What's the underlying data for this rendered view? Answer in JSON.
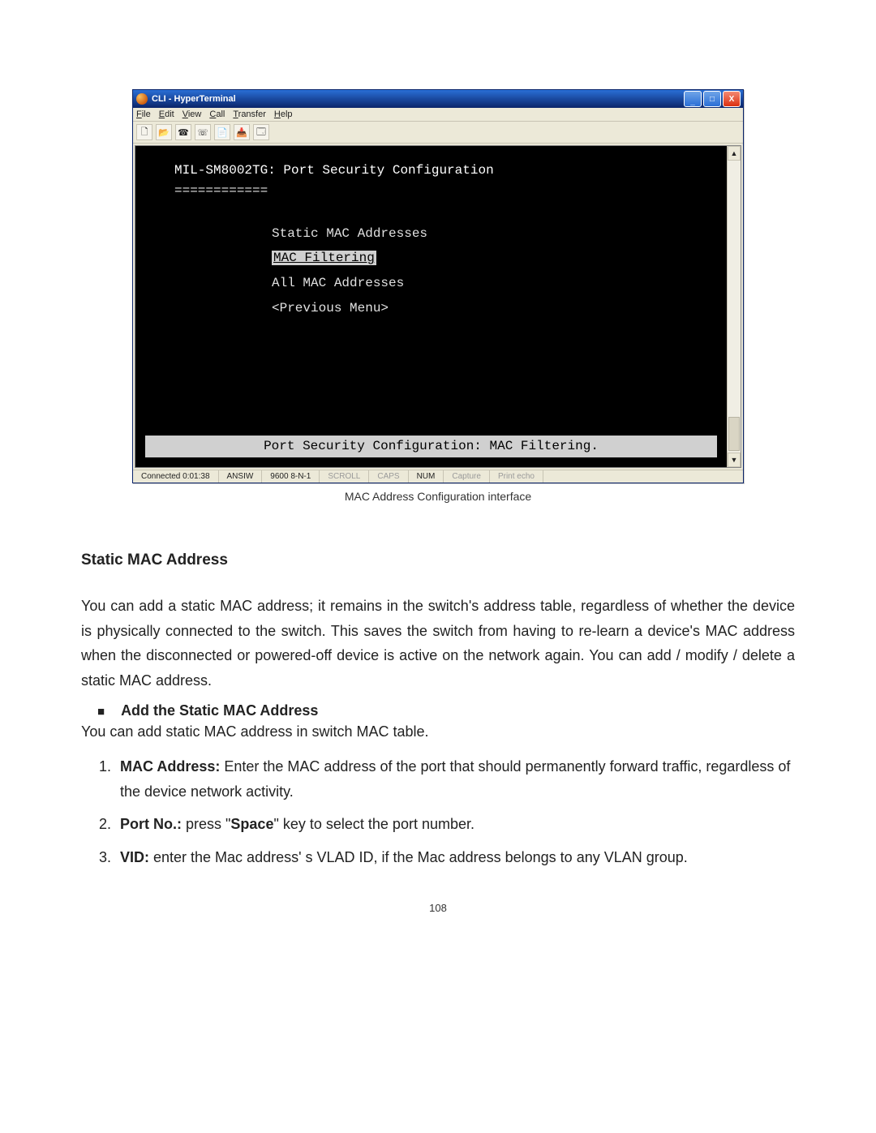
{
  "hyperterminal": {
    "title": "CLI - HyperTerminal",
    "menus": {
      "file": {
        "hot": "F",
        "rest": "ile"
      },
      "edit": {
        "hot": "E",
        "rest": "dit"
      },
      "view": {
        "hot": "V",
        "rest": "iew"
      },
      "call": {
        "hot": "C",
        "rest": "all"
      },
      "transfer": {
        "hot": "T",
        "rest": "ransfer"
      },
      "help": {
        "hot": "H",
        "rest": "elp"
      }
    },
    "window_buttons": {
      "min": "_",
      "max": "□",
      "close": "X"
    },
    "scroll": {
      "up": "▲",
      "down": "▼"
    },
    "terminal": {
      "header": "MIL-SM8002TG: Port Security Configuration",
      "separator": "============",
      "menu_items": [
        {
          "label": "Static MAC Addresses",
          "selected": false
        },
        {
          "label": "MAC Filtering",
          "selected": true
        },
        {
          "label": "All MAC Addresses",
          "selected": false
        },
        {
          "label": "<Previous Menu>",
          "selected": false
        }
      ],
      "hint": "Port Security Configuration: MAC Filtering."
    },
    "status": {
      "connected": "Connected 0:01:38",
      "emulation": "ANSIW",
      "baud": "9600 8-N-1",
      "scroll": "SCROLL",
      "caps": "CAPS",
      "num": "NUM",
      "capture": "Capture",
      "printecho": "Print echo"
    }
  },
  "caption": "MAC Address Configuration interface",
  "doc": {
    "h2": "Static MAC Address",
    "p1": "You can add a static MAC address; it remains in the switch's address table, regardless of whether the device is physically connected to the switch. This saves the switch from having to re-learn a device's MAC address when the disconnected or powered-off device is active on the network again. You can add / modify / delete a static MAC address.",
    "bullet": "Add the Static MAC Address",
    "p2": "You can add static MAC address in switch MAC table.",
    "li1_lead": "MAC Address:",
    "li1_rest": " Enter the MAC address of the port that should permanently forward traffic, regardless of the device network activity.",
    "li2_lead": "Port No.:",
    "li2_mid1": " press \"",
    "li2_key": "Space",
    "li2_mid2": "\" key to select the port number.",
    "li3_lead": "VID:",
    "li3_rest": " enter the Mac address' s VLAD ID, if the Mac address belongs to any VLAN group."
  },
  "page_number": "108"
}
